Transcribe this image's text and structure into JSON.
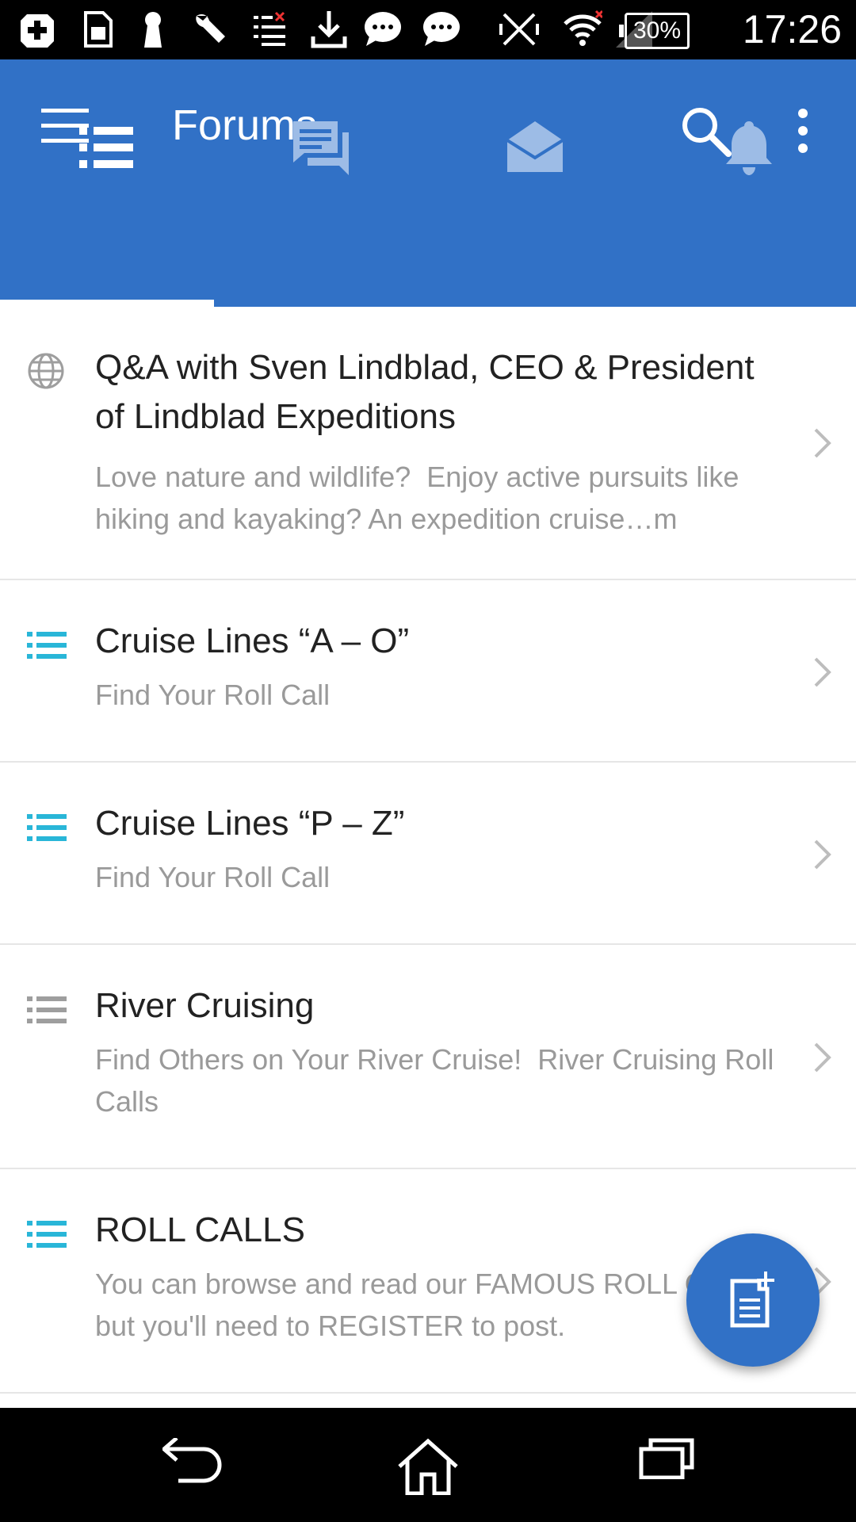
{
  "status_bar": {
    "time": "17:26",
    "battery": "30%",
    "icons": [
      "plus-box-icon",
      "sim-card-icon",
      "keyhole-icon",
      "wrench-icon",
      "task-list-icon",
      "download-icon",
      "chat-icon",
      "chat-icon",
      "vibrate-off-icon",
      "wifi-icon",
      "signal-icon",
      "battery-icon"
    ]
  },
  "app_bar": {
    "title": "Forums",
    "menu_icon": "hamburger-icon",
    "search_icon": "search-icon",
    "more_icon": "more-vertical-icon",
    "bg_color": "#3171C6"
  },
  "tabs": [
    {
      "icon": "list-icon",
      "selected": true
    },
    {
      "icon": "chat-bubbles-icon",
      "selected": false
    },
    {
      "icon": "envelope-open-icon",
      "selected": false
    },
    {
      "icon": "bell-icon",
      "selected": false
    }
  ],
  "forums": [
    {
      "icon": "globe-icon",
      "title": "Q&A with Sven Lindblad, CEO & President of Lindblad Expeditions",
      "subtitle": "Love nature and wildlife?  Enjoy active pursuits like hiking and kayaking? An expedition cruise…m"
    },
    {
      "icon": "list-icon",
      "title": "Cruise Lines “A – O”",
      "subtitle": "Find Your Roll Call"
    },
    {
      "icon": "list-icon",
      "title": "Cruise Lines “P – Z”",
      "subtitle": "Find Your Roll Call"
    },
    {
      "icon": "list-icon",
      "title": "River Cruising",
      "subtitle": "Find Others on Your River Cruise!  River Cruising Roll Calls"
    },
    {
      "icon": "list-icon",
      "title": "ROLL CALLS",
      "subtitle": "You can browse and read our FAMOUS ROLL CALLS, but you'll need to REGISTER to post."
    }
  ],
  "fab": {
    "icon": "new-post-icon"
  },
  "nav_bar": {
    "icons": [
      "back-icon",
      "home-icon",
      "recent-apps-icon"
    ]
  },
  "colors": {
    "accent": "#29B6D8",
    "primary": "#3171C6",
    "muted_icon": "#9E9E9E"
  }
}
